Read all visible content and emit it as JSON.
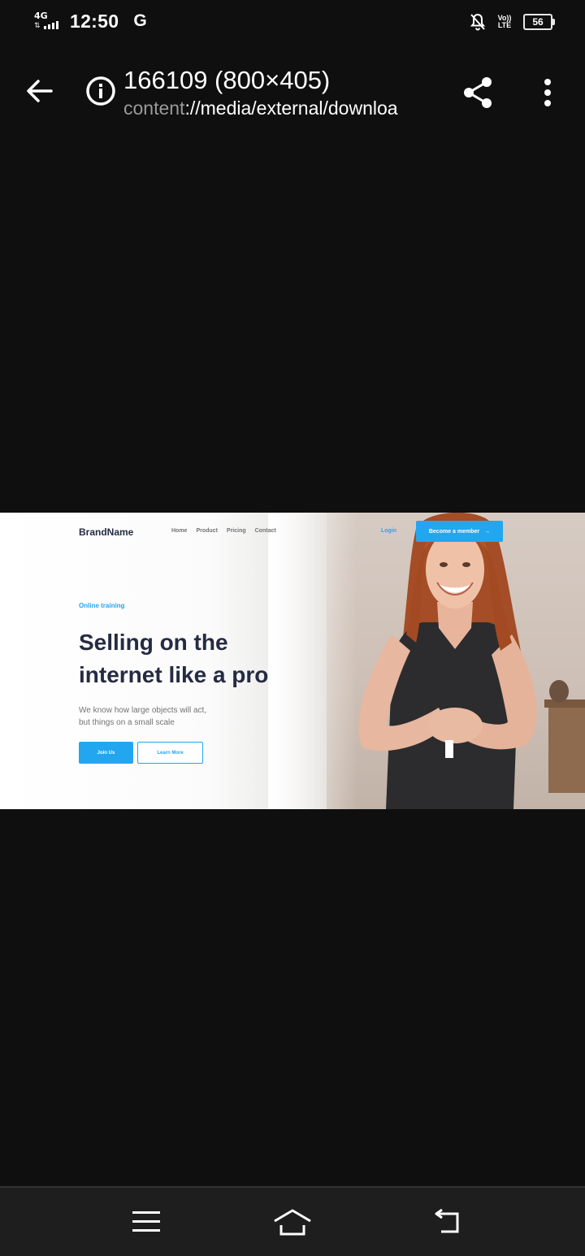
{
  "status_bar": {
    "network_type": "4G",
    "time": "12:50",
    "google_indicator": "G",
    "volte_label_top": "Vo))",
    "volte_label_bottom": "LTE",
    "battery_level": "56",
    "icons": [
      "signal-icon",
      "google-icon",
      "notifications-off-icon",
      "volte-icon",
      "battery-icon"
    ]
  },
  "app_bar": {
    "title": "166109 (800×405)",
    "subtitle_scheme": "content",
    "subtitle_path": "://media/external/downloa",
    "icons": [
      "back-arrow-icon",
      "info-icon",
      "share-icon",
      "more-vert-icon"
    ]
  },
  "image": {
    "brand": "BrandName",
    "nav": [
      "Home",
      "Product",
      "Pricing",
      "Contact"
    ],
    "login": "Login",
    "cta": "Become a member",
    "kicker": "Online training",
    "headline_line1": "Selling on the",
    "headline_line2": "internet like a pro",
    "desc_line1": "We know how large objects will act,",
    "desc_line2": "but things on a small scale",
    "primary_button": "Join Us",
    "secondary_button": "Learn More",
    "accent_color": "#23a6f0",
    "heading_color": "#252b42"
  },
  "nav_bar": {
    "icons": [
      "menu-icon",
      "home-icon",
      "back-icon"
    ]
  }
}
